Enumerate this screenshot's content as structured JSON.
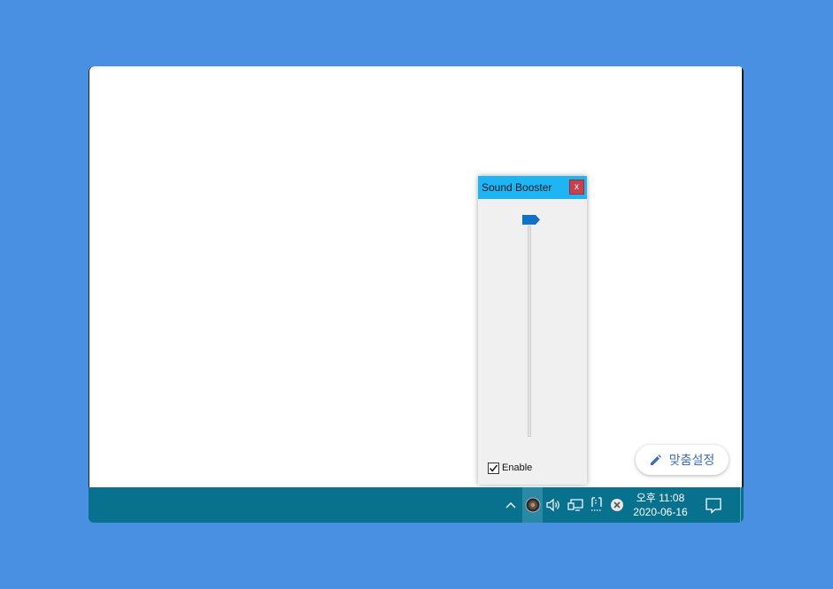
{
  "sound_booster": {
    "title": "Sound Booster",
    "close_label": "x",
    "enable_label": "Enable",
    "enable_checked": true,
    "volume_level": 1.0
  },
  "customize_button": {
    "label": "맞춤설정",
    "icon": "pencil-icon"
  },
  "taskbar": {
    "tray_icons": [
      "chevron-up-icon",
      "sound-booster-tray-icon",
      "speaker-icon",
      "network-icon",
      "device-icon",
      "close-circle-icon"
    ],
    "time": "오후 11:08",
    "date": "2020-06-16",
    "notification_icon": "notification-icon"
  },
  "colors": {
    "background": "#4a90e2",
    "taskbar": "#08718e",
    "titlebar": "#1fb4f3",
    "close_button": "#c5434c",
    "slider_thumb": "#0f72c9",
    "accent_text": "#3d6fb5"
  }
}
